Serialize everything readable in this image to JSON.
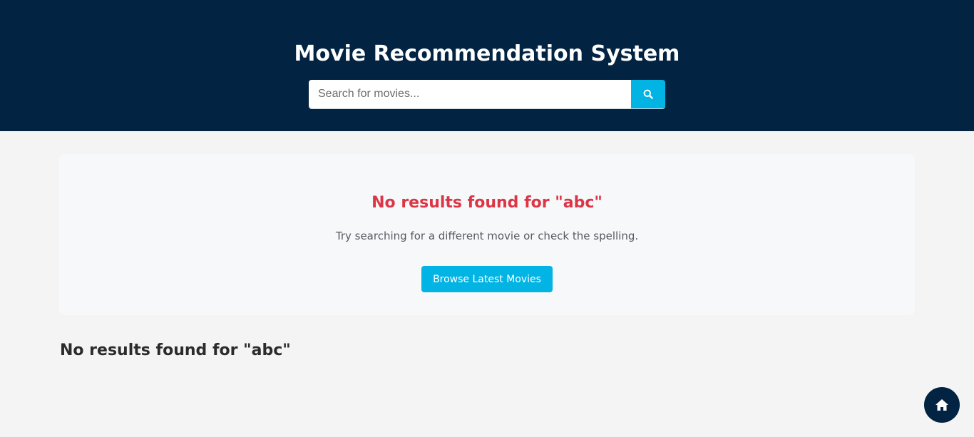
{
  "header": {
    "title": "Movie Recommendation System",
    "search": {
      "placeholder": "Search for movies...",
      "value": "",
      "button_icon": "search-icon"
    }
  },
  "no_results_card": {
    "heading": "No results found for \"abc\"",
    "message": "Try searching for a different movie or check the spelling.",
    "browse_button_label": "Browse Latest Movies"
  },
  "results_section": {
    "heading": "No results found for \"abc\""
  },
  "fab": {
    "icon": "home-icon"
  },
  "colors": {
    "header_bg": "#022442",
    "accent": "#01b4e4",
    "error": "#dc3545",
    "page_bg": "#f4f4f4"
  }
}
